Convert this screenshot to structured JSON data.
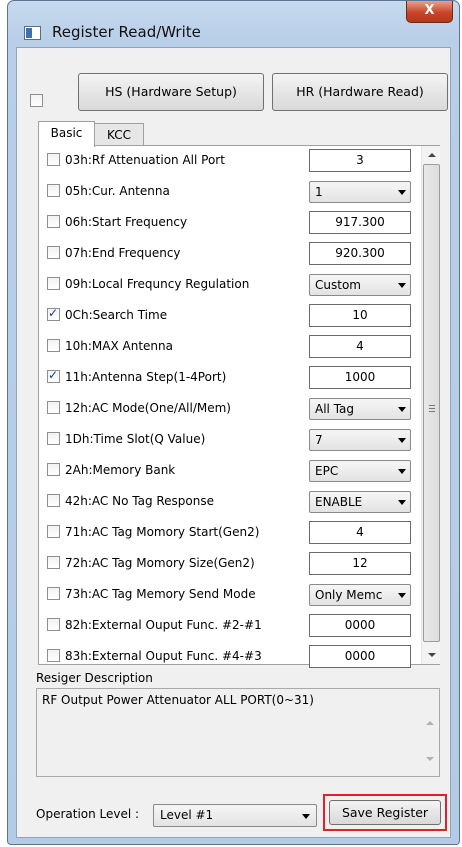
{
  "window": {
    "title": "Register Read/Write",
    "close_label": "X"
  },
  "buttons": {
    "hs": "HS (Hardware Setup)",
    "hr": "HR (Hardware Read)",
    "save": "Save Register"
  },
  "tabs": [
    {
      "label": "Basic",
      "active": true
    },
    {
      "label": "KCC",
      "active": false
    }
  ],
  "registers": [
    {
      "label": "03h:Rf Attenuation All Port",
      "checked": false,
      "type": "text",
      "value": "3"
    },
    {
      "label": "05h:Cur. Antenna",
      "checked": false,
      "type": "select",
      "value": "1"
    },
    {
      "label": "06h:Start Frequency",
      "checked": false,
      "type": "text",
      "value": "917.300"
    },
    {
      "label": "07h:End Frequency",
      "checked": false,
      "type": "text",
      "value": "920.300"
    },
    {
      "label": "09h:Local Frequncy Regulation",
      "checked": false,
      "type": "select",
      "value": "Custom"
    },
    {
      "label": "0Ch:Search Time",
      "checked": true,
      "type": "text",
      "value": "10"
    },
    {
      "label": "10h:MAX Antenna",
      "checked": false,
      "type": "text",
      "value": "4"
    },
    {
      "label": "11h:Antenna Step(1-4Port)",
      "checked": true,
      "type": "text",
      "value": "1000"
    },
    {
      "label": "12h:AC Mode(One/All/Mem)",
      "checked": false,
      "type": "select",
      "value": "All Tag"
    },
    {
      "label": "1Dh:Time Slot(Q Value)",
      "checked": false,
      "type": "select",
      "value": "7"
    },
    {
      "label": "2Ah:Memory Bank",
      "checked": false,
      "type": "select",
      "value": "EPC"
    },
    {
      "label": "42h:AC No Tag Response",
      "checked": false,
      "type": "select",
      "value": "ENABLE"
    },
    {
      "label": "71h:AC Tag Momory Start(Gen2)",
      "checked": false,
      "type": "text",
      "value": "4"
    },
    {
      "label": "72h:AC Tag Momory Size(Gen2)",
      "checked": false,
      "type": "text",
      "value": "12"
    },
    {
      "label": "73h:AC Tag Memory Send Mode",
      "checked": false,
      "type": "select",
      "value": "Only Memc"
    },
    {
      "label": "82h:External Ouput Func. #2-#1",
      "checked": false,
      "type": "text",
      "value": "0000"
    },
    {
      "label": "83h:External Ouput Func. #4-#3",
      "checked": false,
      "type": "text",
      "value": "0000"
    }
  ],
  "description": {
    "label": "Resiger Description",
    "text": "RF Output Power Attenuator ALL PORT(0~31)"
  },
  "operation": {
    "label": "Operation Level :",
    "value": "Level #1"
  }
}
